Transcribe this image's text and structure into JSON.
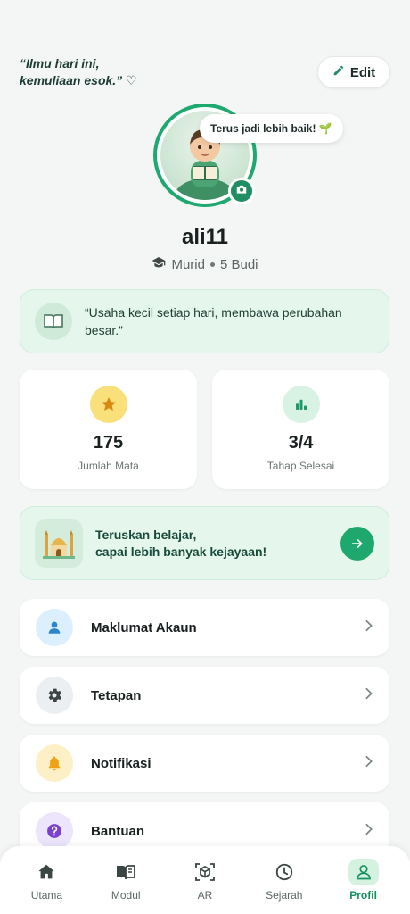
{
  "header": {
    "quote_line1": "“Ilmu hari ini,",
    "quote_line2": "kemuliaan esok.” ♡",
    "edit_label": "Edit"
  },
  "profile": {
    "bubble_text": "Terus jadi lebih baik! 🌱",
    "username": "ali11",
    "role": "Murid",
    "class": "5 Budi"
  },
  "motto": {
    "text": "“Usaha kecil setiap hari, membawa perubahan besar.”"
  },
  "stats": [
    {
      "value": "175",
      "label": "Jumlah Mata",
      "icon": "star-icon"
    },
    {
      "value": "3/4",
      "label": "Tahap Selesai",
      "icon": "bar-chart-icon"
    }
  ],
  "cta": {
    "line1": "Teruskan belajar,",
    "line2": "capai lebih banyak kejayaan!"
  },
  "menu": [
    {
      "label": "Maklumat Akaun",
      "icon": "user-icon"
    },
    {
      "label": "Tetapan",
      "icon": "gear-icon"
    },
    {
      "label": "Notifikasi",
      "icon": "bell-icon"
    },
    {
      "label": "Bantuan",
      "icon": "help-icon"
    }
  ],
  "nav": [
    {
      "label": "Utama",
      "icon": "home-icon"
    },
    {
      "label": "Modul",
      "icon": "book-icon"
    },
    {
      "label": "AR",
      "icon": "ar-cube-icon"
    },
    {
      "label": "Sejarah",
      "icon": "clock-icon"
    },
    {
      "label": "Profil",
      "icon": "profile-icon",
      "active": true
    }
  ],
  "colors": {
    "accent": "#1fa86e",
    "accent_dark": "#1f8e63",
    "mint_bg": "#e5f6ec",
    "star_yellow": "#f9e07a",
    "background": "#f4f6f5"
  }
}
